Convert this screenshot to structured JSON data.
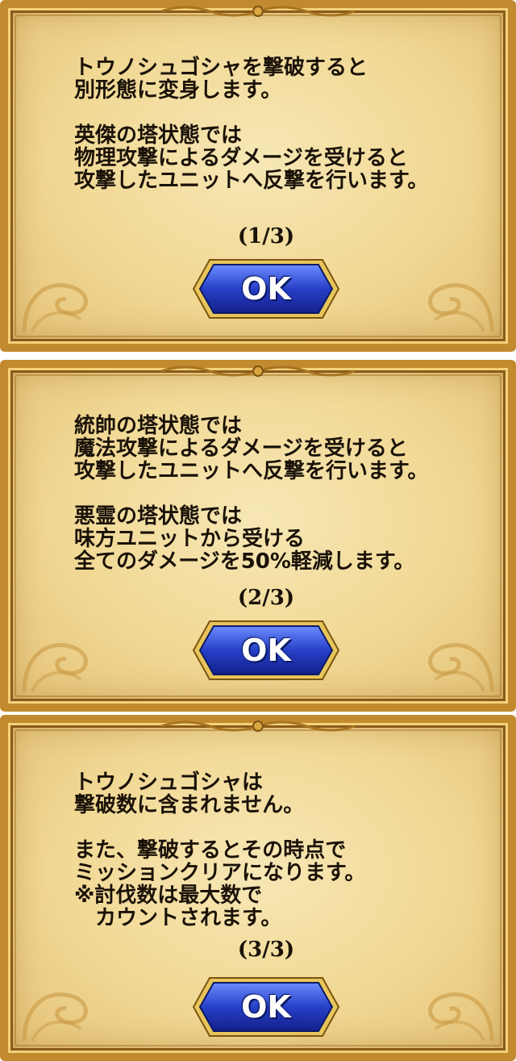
{
  "dialogs": [
    {
      "message": "トウノシュゴシャを撃破すると\n別形態に変身します。\n\n英傑の塔状態では\n物理攻撃によるダメージを受けると\n攻撃したユニットへ反撃を行います。",
      "page_indicator": "(1/3)",
      "button_label": "OK"
    },
    {
      "message": "統帥の塔状態では\n魔法攻撃によるダメージを受けると\n攻撃したユニットへ反撃を行います。\n\n悪霊の塔状態では\n味方ユニットから受ける\n全てのダメージを50%軽減します。",
      "page_indicator": "(2/3)",
      "button_label": "OK"
    },
    {
      "message": "トウノシュゴシャは\n撃破数に含まれません。\n\nまた、撃破するとその時点で\nミッションクリアになります。\n※討伐数は最大数で\n　カウントされます。",
      "page_indicator": "(3/3)",
      "button_label": "OK"
    }
  ],
  "colors": {
    "frame_gold": "#c28a2e",
    "parchment": "#f1d894",
    "button_blue": "#2740c8",
    "button_border": "#e8c55a",
    "text": "#1a1208"
  },
  "icons": {
    "frame_ornament": "gold-scroll-ornament-icon",
    "button_shape": "hexagon-button-shape"
  }
}
